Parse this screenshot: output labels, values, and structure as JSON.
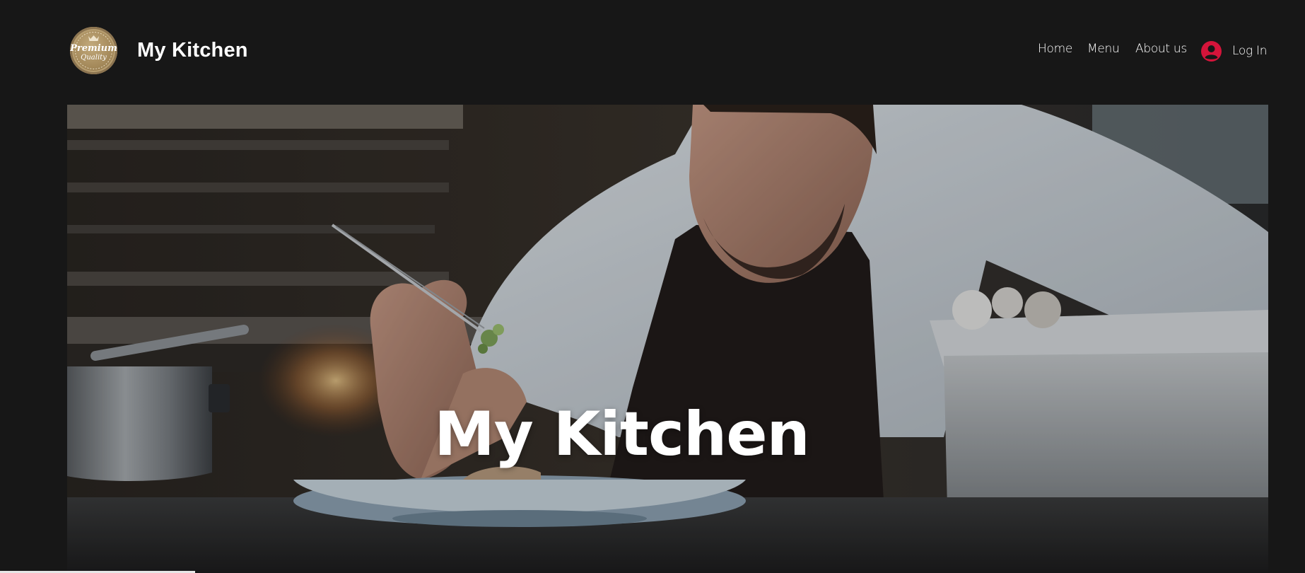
{
  "header": {
    "site_title": "My Kitchen",
    "logo": {
      "icon": "premium-quality-badge",
      "text_line1": "Premium",
      "text_line2": "Quality"
    },
    "nav": [
      {
        "label": "Home"
      },
      {
        "label": "Menu"
      },
      {
        "label": "About us"
      }
    ],
    "login": {
      "label": "Log In",
      "icon": "user-avatar-icon",
      "icon_color": "#d4143a"
    }
  },
  "hero": {
    "title": "My Kitchen",
    "image": "chef-plating-dish-photo"
  },
  "colors": {
    "page_background": "#171717",
    "text": "#ffffff",
    "accent": "#d4143a"
  }
}
